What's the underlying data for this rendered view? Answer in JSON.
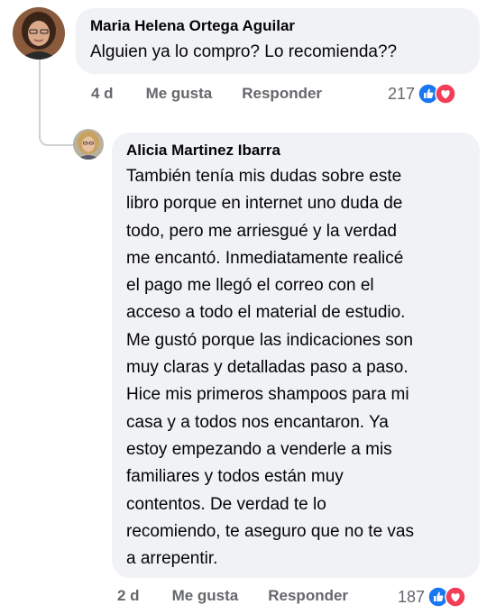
{
  "comments": [
    {
      "author": "Maria Helena Ortega Aguilar",
      "text": "Alguien ya lo compro? Lo recomienda??",
      "time": "4 d",
      "like_label": "Me gusta",
      "reply_label": "Responder",
      "reaction_count": "217",
      "reaction_icons": [
        "like-icon",
        "love-icon"
      ]
    },
    {
      "author": "Alicia Martinez Ibarra",
      "lines": [
        "También tenía mis dudas sobre este",
        "libro porque en internet uno duda de",
        "todo, pero me arriesgué y la verdad",
        "me encantó. Inmediatamente realicé",
        "el pago me llegó el correo con el",
        "acceso a todo el material de estudio.",
        "Me gustó porque las indicaciones son",
        "muy claras y detalladas paso a paso.",
        "Hice mis primeros shampoos para mi",
        "casa y a todos nos encantaron. Ya",
        "estoy empezando a venderle a mis",
        "familiares y todos están muy",
        "contentos. De verdad te lo",
        "recomiendo, te aseguro que no te vas",
        "a arrepentir."
      ],
      "time": "2 d",
      "like_label": "Me gusta",
      "reply_label": "Responder",
      "reaction_count": "187",
      "reaction_icons": [
        "like-icon",
        "love-icon"
      ]
    }
  ],
  "colors": {
    "bubble": "#f0f2f5",
    "meta_text": "#65676b",
    "like_blue": "#1877f2",
    "love_red": "#f33e58"
  }
}
